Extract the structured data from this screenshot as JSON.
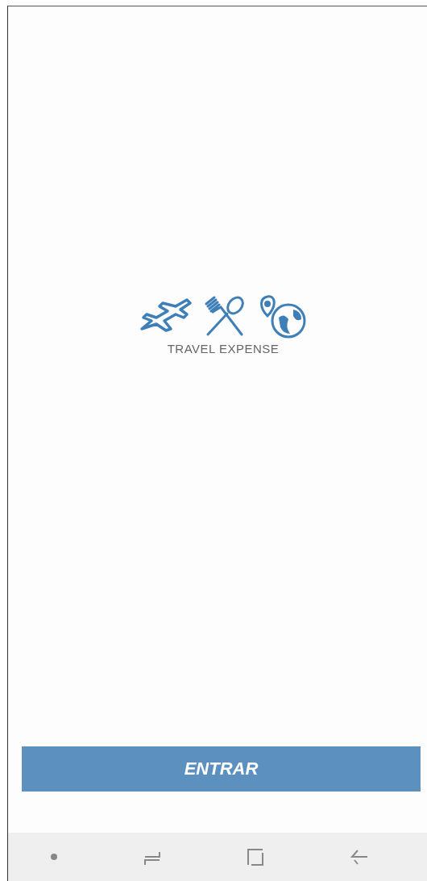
{
  "logo": {
    "caption": "TRAVEL EXPENSE"
  },
  "button": {
    "label": "ENTRAR"
  }
}
